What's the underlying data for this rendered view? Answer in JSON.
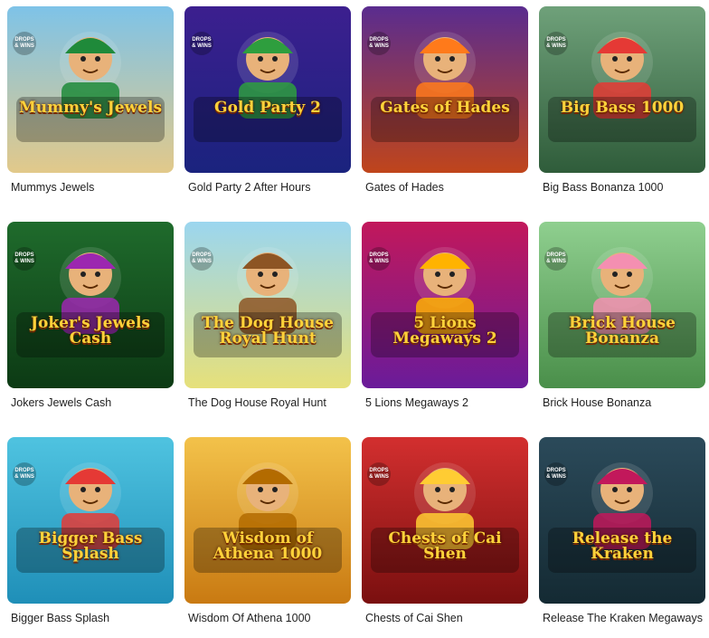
{
  "badge_text": "DROPS & WINS",
  "games": [
    {
      "name": "Mummys Jewels",
      "art": "Mummy's Jewels",
      "icon": "pharaoh-icon",
      "bg": [
        "#7ec3e8",
        "#e2c98a"
      ],
      "accent": "#1f8a3a",
      "badge": true
    },
    {
      "name": "Gold Party 2 After Hours",
      "art": "Gold Party 2",
      "icon": "leprechaun-icon",
      "bg": [
        "#3c1f8f",
        "#1a237e"
      ],
      "accent": "#2e9e3e",
      "badge": true
    },
    {
      "name": "Gates of Hades",
      "art": "Gates of Hades",
      "icon": "hades-icon",
      "bg": [
        "#5a2c8f",
        "#c0451b"
      ],
      "accent": "#ff7a1a",
      "badge": true
    },
    {
      "name": "Big Bass Bonanza 1000",
      "art": "Big Bass 1000",
      "icon": "fisherman-icon",
      "bg": [
        "#6fa17a",
        "#2f5c3a"
      ],
      "accent": "#e53935",
      "badge": true
    },
    {
      "name": "Jokers Jewels Cash",
      "art": "Joker's Jewels Cash",
      "icon": "joker-icon",
      "bg": [
        "#1f6b2c",
        "#0c3a14"
      ],
      "accent": "#9c27b0",
      "badge": true
    },
    {
      "name": "The Dog House Royal Hunt",
      "art": "The Dog House Royal Hunt",
      "icon": "dog-icon",
      "bg": [
        "#9bd6ef",
        "#e6e07a"
      ],
      "accent": "#8d5524",
      "badge": true
    },
    {
      "name": "5 Lions Megaways 2",
      "art": "5 Lions Megaways 2",
      "icon": "lion-icon",
      "bg": [
        "#c2185b",
        "#6a1b9a"
      ],
      "accent": "#ffb300",
      "badge": true
    },
    {
      "name": "Brick House Bonanza",
      "art": "Brick House Bonanza",
      "icon": "pig-icon",
      "bg": [
        "#8fcf8f",
        "#4a8f4a"
      ],
      "accent": "#f48fb1",
      "badge": true
    },
    {
      "name": "Bigger Bass Splash",
      "art": "Bigger Bass Splash",
      "icon": "fisherman-icon",
      "bg": [
        "#4fc3e0",
        "#1f8fb8"
      ],
      "accent": "#e53935",
      "badge": true
    },
    {
      "name": "Wisdom Of Athena 1000",
      "art": "Wisdom of Athena 1000",
      "icon": "athena-icon",
      "bg": [
        "#f3c24a",
        "#c97a12"
      ],
      "accent": "#b36b00",
      "badge": false
    },
    {
      "name": "Chests of Cai Shen",
      "art": "Chests of Cai Shen",
      "icon": "cai-shen-icon",
      "bg": [
        "#d32f2f",
        "#7a0f0f"
      ],
      "accent": "#ffcc33",
      "badge": true
    },
    {
      "name": "Release The Kraken Megaways",
      "art": "Release the Kraken",
      "icon": "kraken-icon",
      "bg": [
        "#2b4a5a",
        "#142a33"
      ],
      "accent": "#c2185b",
      "badge": true
    }
  ]
}
